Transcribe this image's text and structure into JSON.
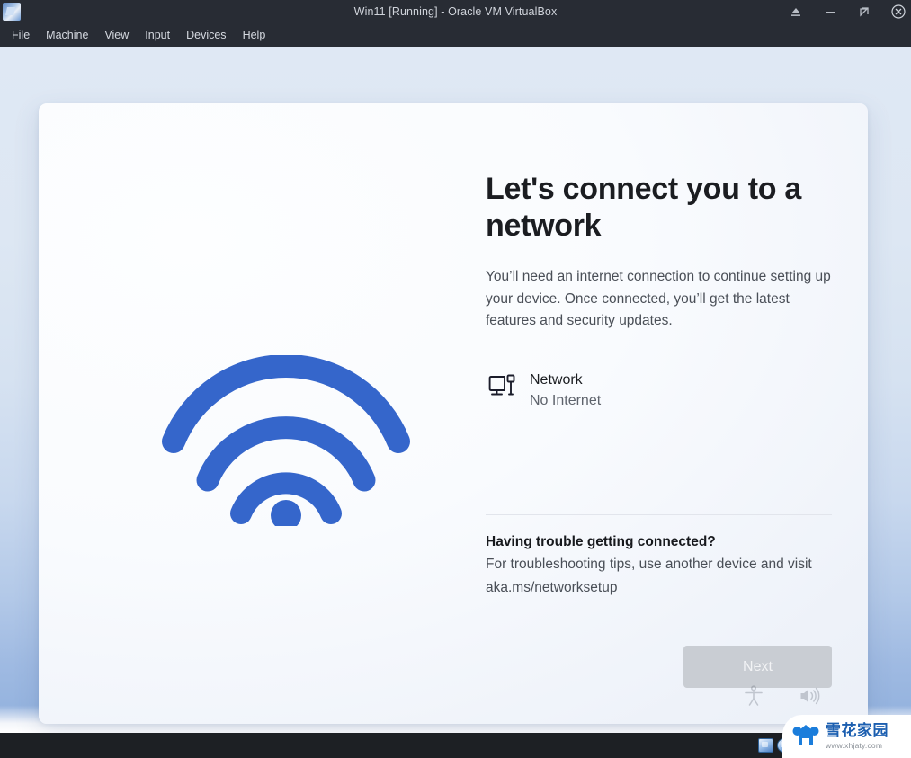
{
  "window": {
    "title": "Win11 [Running] - Oracle VM VirtualBox",
    "app_icon": "virtualbox-icon",
    "buttons": [
      {
        "name": "eject-button",
        "label": "Eject"
      },
      {
        "name": "minimize-button",
        "label": "Minimize"
      },
      {
        "name": "restore-button",
        "label": "Restore"
      },
      {
        "name": "close-button",
        "label": "Close"
      }
    ],
    "menu": [
      {
        "label": "File"
      },
      {
        "label": "Machine"
      },
      {
        "label": "View"
      },
      {
        "label": "Input"
      },
      {
        "label": "Devices"
      },
      {
        "label": "Help"
      }
    ]
  },
  "oobe": {
    "illustration": "wifi-icon",
    "heading": "Let's connect you to a network",
    "body": "You’ll need an internet connection to continue setting up your device. Once connected, you’ll get the latest features and security updates.",
    "network_item": {
      "icon": "ethernet-monitor-icon",
      "name": "Network",
      "status": "No Internet"
    },
    "troubleshoot": {
      "heading": "Having trouble getting connected?",
      "body": "For troubleshooting tips, use another device and visit aka.ms/networksetup"
    },
    "next_button": {
      "label": "Next",
      "enabled": false
    },
    "controls": [
      {
        "name": "accessibility-icon",
        "label": "Accessibility"
      },
      {
        "name": "sound-icon",
        "label": "Narrator volume"
      }
    ]
  },
  "statusbar": {
    "icons": [
      {
        "name": "hard-disk-icon"
      },
      {
        "name": "optical-drive-icon"
      },
      {
        "name": "audio-icon"
      },
      {
        "name": "network-adapter-icon"
      },
      {
        "name": "usb-icon"
      },
      {
        "name": "shared-folders-icon"
      },
      {
        "name": "display-icon"
      },
      {
        "name": "recording-icon"
      }
    ]
  },
  "watermark": {
    "name": "雪花家园",
    "url": "www.xhjaty.com"
  },
  "colors": {
    "accent_blue": "#3366cc",
    "vm_background_top": "#dfe8f4",
    "vm_background_bottom": "#96b4df",
    "card": "#f9fbfe",
    "chrome": "#282c34",
    "statusbar": "#1d2024",
    "disabled_button": "#c9cdd3",
    "watermark_blue": "#1c5fb0"
  }
}
